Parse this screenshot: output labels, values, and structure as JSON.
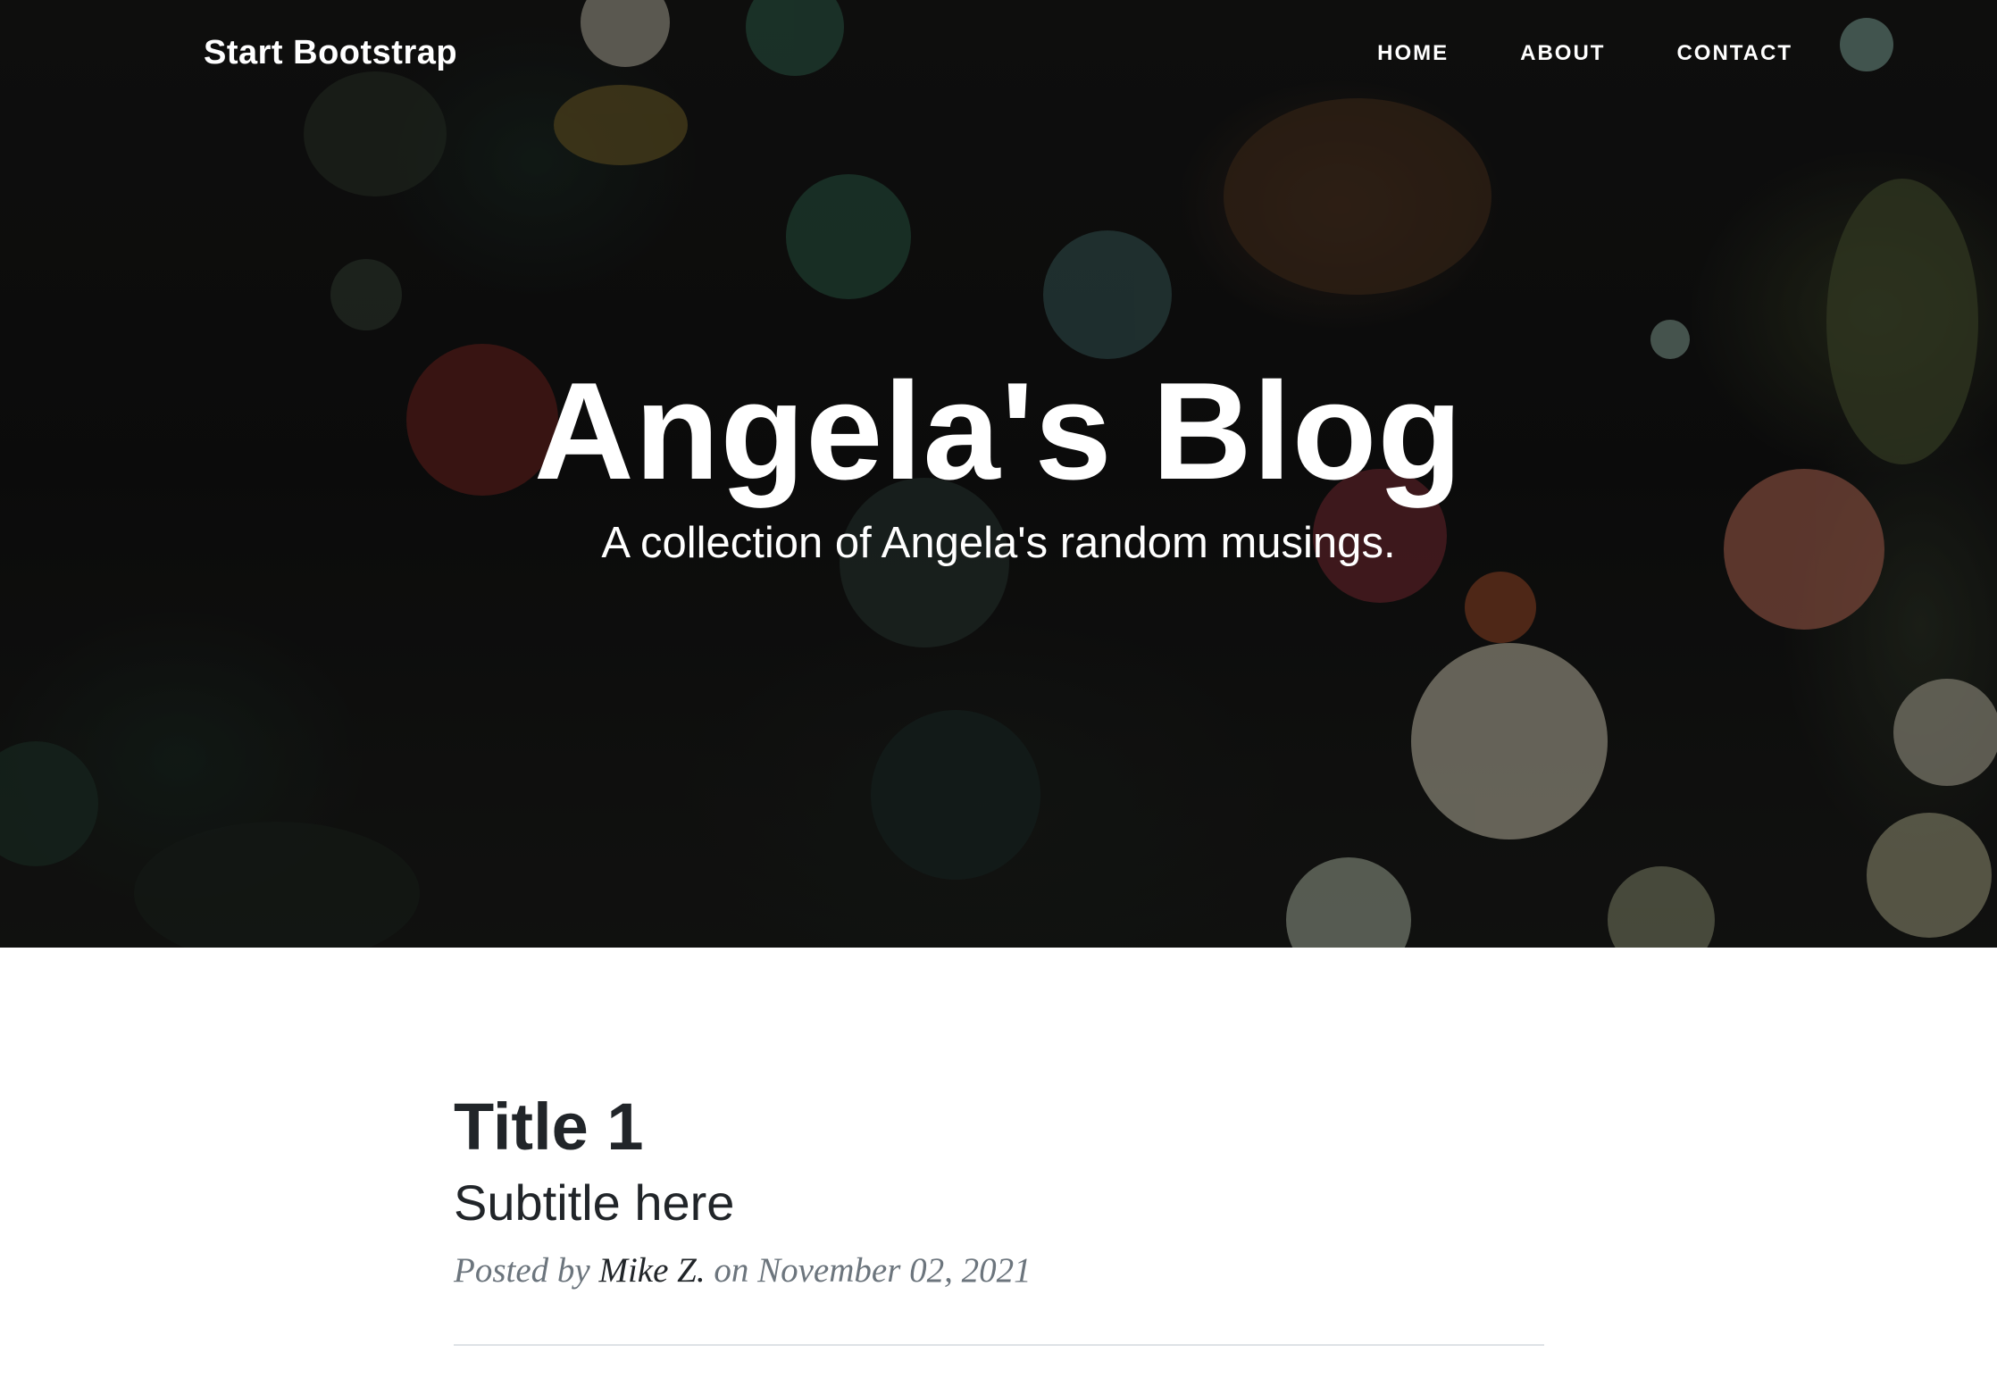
{
  "navbar": {
    "brand": "Start Bootstrap",
    "links": [
      {
        "label": "HOME"
      },
      {
        "label": "ABOUT"
      },
      {
        "label": "CONTACT"
      }
    ]
  },
  "hero": {
    "title": "Angela's Blog",
    "subtitle": "A collection of Angela's random musings."
  },
  "posts": [
    {
      "title": "Title 1",
      "subtitle": "Subtitle here",
      "meta_prefix": "Posted by",
      "author": "Mike Z.",
      "meta_suffix": "on November 02, 2021"
    }
  ],
  "colors": {
    "heading": "#212529",
    "meta": "#6c757d",
    "divider": "#dee2e6",
    "hero_overlay": "#141414"
  }
}
